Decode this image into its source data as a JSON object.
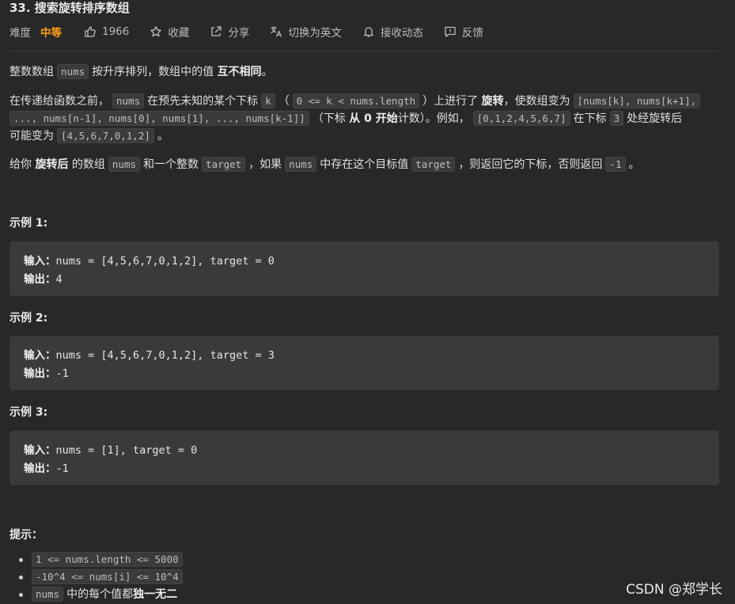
{
  "problem": {
    "title": "33. 搜索旋转排序数组",
    "difficulty_label": "难度",
    "difficulty_value": "中等",
    "likes": "1966",
    "collect_label": "收藏",
    "share_label": "分享",
    "translate_label": "切换为英文",
    "notify_label": "接收动态",
    "feedback_label": "反馈"
  },
  "description": {
    "p1": {
      "a": "整数数组",
      "c1": "nums",
      "b": "按升序排列，数组中的值",
      "bold": "互不相同",
      "end": "。"
    },
    "p2": {
      "a": "在传递给函数之前，",
      "c1": "nums",
      "b": "在预先未知的某个下标",
      "c2": "k",
      "c3": "0 <= k < nums.length",
      "d": "上进行了",
      "bold": "旋转",
      "e": "，使数组变为",
      "c4": "[nums[k], nums[k+1],",
      "c5": "..., nums[n-1], nums[0], nums[1], ..., nums[k-1]]",
      "f": "（下标",
      "bold2": "从 0 开始",
      "g": "计数）。例如，",
      "c6": "[0,1,2,4,5,6,7]",
      "h": "在下标",
      "c7": "3",
      "i": "处经旋转后",
      "j": "可能变为",
      "c8": "[4,5,6,7,0,1,2]",
      "end": "。"
    },
    "p3": {
      "a": "给你",
      "bold": "旋转后",
      "b": "的数组",
      "c1": "nums",
      "c": "和一个整数",
      "c2": "target",
      "d": "，如果",
      "c3": "nums",
      "e": "中存在这个目标值",
      "c4": "target",
      "f": "，则返回它的下标，否则返回",
      "c5": "-1",
      "end": "。"
    }
  },
  "examples": [
    {
      "heading": "示例 1:",
      "input_label": "输入：",
      "input": "nums = [4,5,6,7,0,1,2], target = 0",
      "output_label": "输出：",
      "output": "4"
    },
    {
      "heading": "示例 2:",
      "input_label": "输入：",
      "input": "nums = [4,5,6,7,0,1,2], target = 3",
      "output_label": "输出：",
      "output": "-1"
    },
    {
      "heading": "示例 3:",
      "input_label": "输入：",
      "input": "nums = [1], target = 0",
      "output_label": "输出：",
      "output": "-1"
    }
  ],
  "hints": {
    "heading": "提示：",
    "items": [
      {
        "code": "1 <= nums.length <= 5000",
        "text": "",
        "bold": ""
      },
      {
        "code": "-10^4 <= nums[i] <= 10^4",
        "text": "",
        "bold": ""
      },
      {
        "code": "nums",
        "text": "中的每个值都",
        "bold": "独一无二"
      }
    ]
  },
  "watermark": "CSDN @郑学长"
}
